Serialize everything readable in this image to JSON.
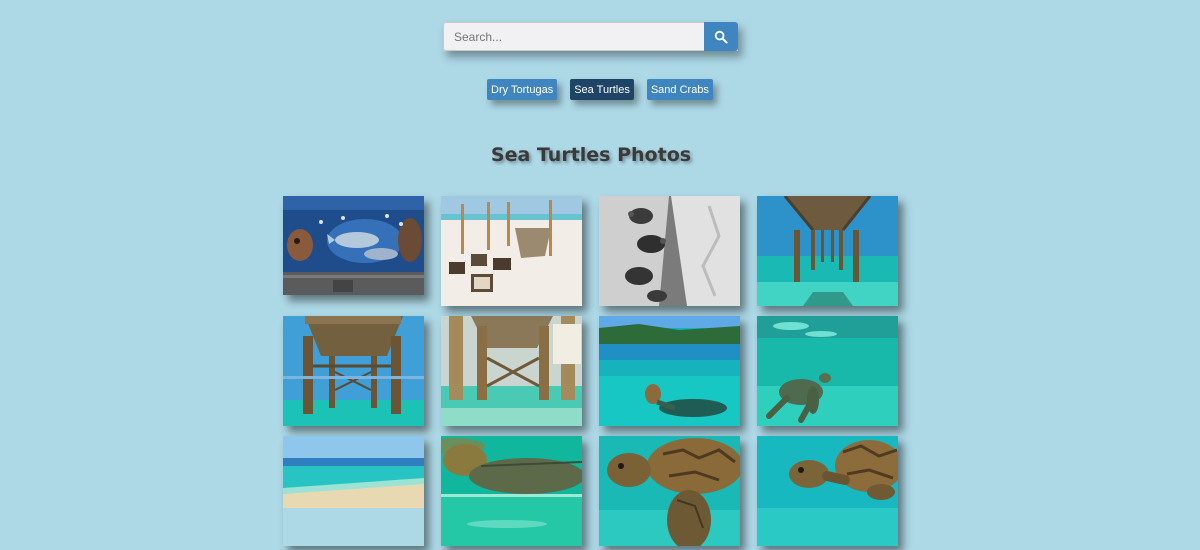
{
  "search": {
    "placeholder": "Search...",
    "button_icon": "search-icon"
  },
  "filters": [
    {
      "label": "Dry Tortugas",
      "active": false
    },
    {
      "label": "Sea Turtles",
      "active": true
    },
    {
      "label": "Sand Crabs",
      "active": false
    }
  ],
  "page_title": "Sea Turtles Photos",
  "colors": {
    "background": "#add8e6",
    "button": "#3f86c0",
    "button_active": "#1e4566",
    "title": "#3a3a3a"
  },
  "gallery": [
    {
      "subject": "dolphin-mural-photo"
    },
    {
      "subject": "beach-crates-photo"
    },
    {
      "subject": "turtle-tattoo-photo"
    },
    {
      "subject": "pier-underside-photo"
    },
    {
      "subject": "pier-pilings-photo"
    },
    {
      "subject": "pier-pilings-shallow-photo"
    },
    {
      "subject": "turtle-surfacing-photo"
    },
    {
      "subject": "turtle-swimming-photo"
    },
    {
      "subject": "shoreline-photo"
    },
    {
      "subject": "turtle-grazing-photo"
    },
    {
      "subject": "turtle-closeup-photo"
    },
    {
      "subject": "turtle-underwater-photo"
    }
  ]
}
